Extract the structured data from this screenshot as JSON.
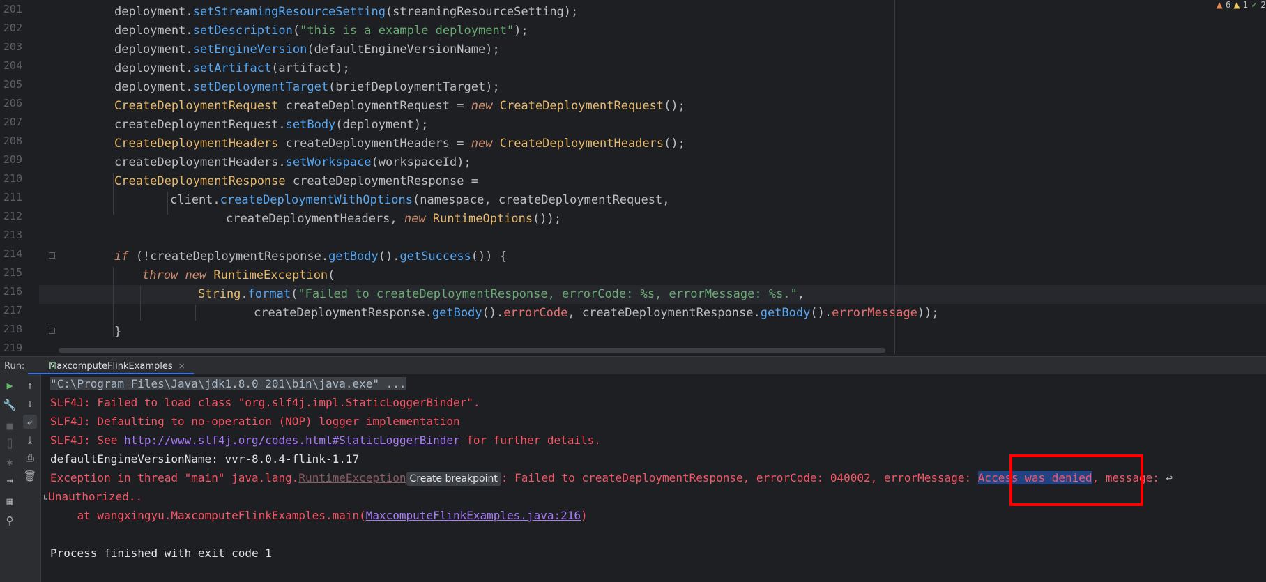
{
  "editor": {
    "line_numbers": [
      "201",
      "202",
      "203",
      "204",
      "205",
      "206",
      "207",
      "208",
      "209",
      "210",
      "211",
      "212",
      "213",
      "214",
      "215",
      "216",
      "217",
      "218",
      "219"
    ],
    "lines": [
      {
        "indent": 2,
        "tokens": [
          {
            "t": "deployment."
          },
          {
            "t": "setStreamingResourceSetting",
            "c": "m"
          },
          {
            "t": "(streamingResourceSetting);"
          }
        ]
      },
      {
        "indent": 2,
        "tokens": [
          {
            "t": "deployment."
          },
          {
            "t": "setDescription",
            "c": "m"
          },
          {
            "t": "("
          },
          {
            "t": "\"this is a example deployment\"",
            "c": "str"
          },
          {
            "t": ");"
          }
        ]
      },
      {
        "indent": 2,
        "tokens": [
          {
            "t": "deployment."
          },
          {
            "t": "setEngineVersion",
            "c": "m"
          },
          {
            "t": "(defaultEngineVersionName);"
          }
        ]
      },
      {
        "indent": 2,
        "tokens": [
          {
            "t": "deployment."
          },
          {
            "t": "setArtifact",
            "c": "m"
          },
          {
            "t": "(artifact);"
          }
        ]
      },
      {
        "indent": 2,
        "tokens": [
          {
            "t": "deployment."
          },
          {
            "t": "setDeploymentTarget",
            "c": "m"
          },
          {
            "t": "(briefDeploymentTarget);"
          }
        ]
      },
      {
        "indent": 2,
        "tokens": [
          {
            "t": "CreateDeploymentRequest",
            "c": "cls"
          },
          {
            "t": " createDeploymentRequest = "
          },
          {
            "t": "new",
            "c": "kw"
          },
          {
            "t": " "
          },
          {
            "t": "CreateDeploymentRequest",
            "c": "cls"
          },
          {
            "t": "();"
          }
        ]
      },
      {
        "indent": 2,
        "tokens": [
          {
            "t": "createDeploymentRequest."
          },
          {
            "t": "setBody",
            "c": "m"
          },
          {
            "t": "(deployment);"
          }
        ]
      },
      {
        "indent": 2,
        "tokens": [
          {
            "t": "CreateDeploymentHeaders",
            "c": "cls"
          },
          {
            "t": " createDeploymentHeaders = "
          },
          {
            "t": "new",
            "c": "kw"
          },
          {
            "t": " "
          },
          {
            "t": "CreateDeploymentHeaders",
            "c": "cls"
          },
          {
            "t": "();"
          }
        ]
      },
      {
        "indent": 2,
        "tokens": [
          {
            "t": "createDeploymentHeaders."
          },
          {
            "t": "setWorkspace",
            "c": "m"
          },
          {
            "t": "(workspaceId);"
          }
        ]
      },
      {
        "indent": 2,
        "tokens": [
          {
            "t": "CreateDeploymentResponse",
            "c": "cls"
          },
          {
            "t": " createDeploymentResponse ="
          }
        ]
      },
      {
        "indent": 4,
        "tokens": [
          {
            "t": "client."
          },
          {
            "t": "createDeploymentWithOptions",
            "c": "m"
          },
          {
            "t": "(namespace, createDeploymentRequest,"
          }
        ]
      },
      {
        "indent": 6,
        "tokens": [
          {
            "t": "createDeploymentHeaders, "
          },
          {
            "t": "new",
            "c": "kw"
          },
          {
            "t": " "
          },
          {
            "t": "RuntimeOptions",
            "c": "cls"
          },
          {
            "t": "());"
          }
        ]
      },
      {
        "indent": 0,
        "tokens": []
      },
      {
        "indent": 2,
        "tokens": [
          {
            "t": "if",
            "c": "kw"
          },
          {
            "t": " (!createDeploymentResponse."
          },
          {
            "t": "getBody",
            "c": "m"
          },
          {
            "t": "()."
          },
          {
            "t": "getSuccess",
            "c": "m"
          },
          {
            "t": "()) {"
          }
        ]
      },
      {
        "indent": 3,
        "tokens": [
          {
            "t": "throw",
            "c": "kw"
          },
          {
            "t": " "
          },
          {
            "t": "new",
            "c": "kw"
          },
          {
            "t": " "
          },
          {
            "t": "RuntimeException",
            "c": "cls"
          },
          {
            "t": "("
          }
        ]
      },
      {
        "indent": 5,
        "tokens": [
          {
            "t": "String",
            "c": "cls"
          },
          {
            "t": "."
          },
          {
            "t": "format",
            "c": "m"
          },
          {
            "t": "("
          },
          {
            "t": "\"Failed to createDeploymentResponse, errorCode: %s, errorMessage: %s.\"",
            "c": "str"
          },
          {
            "t": ","
          }
        ]
      },
      {
        "indent": 7,
        "tokens": [
          {
            "t": "createDeploymentResponse."
          },
          {
            "t": "getBody",
            "c": "m"
          },
          {
            "t": "()."
          },
          {
            "t": "errorCode",
            "c": "fld"
          },
          {
            "t": ", createDeploymentResponse."
          },
          {
            "t": "getBody",
            "c": "m"
          },
          {
            "t": "()."
          },
          {
            "t": "errorMessage",
            "c": "fld"
          },
          {
            "t": "));"
          }
        ]
      },
      {
        "indent": 2,
        "tokens": [
          {
            "t": "}"
          }
        ]
      },
      {
        "indent": 0,
        "tokens": []
      }
    ],
    "inspections": {
      "warnings": "6",
      "weak_warnings": "1",
      "ok": "2"
    }
  },
  "run_panel": {
    "label": "Run:",
    "tab_name": "MaxcomputeFlinkExamples",
    "tab_close": "×",
    "console": {
      "cmd": "\"C:\\Program Files\\Java\\jdk1.8.0_201\\bin\\java.exe\" ...",
      "slf4j_1": "SLF4J: Failed to load class \"org.slf4j.impl.StaticLoggerBinder\".",
      "slf4j_2": "SLF4J: Defaulting to no-operation (NOP) logger implementation",
      "slf4j_3_prefix": "SLF4J: See ",
      "slf4j_3_link": "http://www.slf4j.org/codes.html#StaticLoggerBinder",
      "slf4j_3_suffix": " for further details.",
      "engine_version": "defaultEngineVersionName: vvr-8.0.4-flink-1.17",
      "exc_prefix": "Exception in thread \"main\" java.lang.",
      "exc_class": "RuntimeException",
      "bp_hint": "Create breakpoint",
      "exc_mid": ": Failed to createDeploymentResponse, errorCode: 040002, errorMessage: ",
      "exc_highlight": "Access was denied",
      "exc_suffix": ", message: ",
      "wrap_icon": "↩",
      "unauth": "Unauthorized..",
      "unauth_icon": "↳",
      "stack_prefix": "    at wangxingyu.MaxcomputeFlinkExamples.main(",
      "stack_link": "MaxcomputeFlinkExamples.java:216",
      "stack_suffix": ")",
      "exit": "Process finished with exit code 1"
    }
  }
}
